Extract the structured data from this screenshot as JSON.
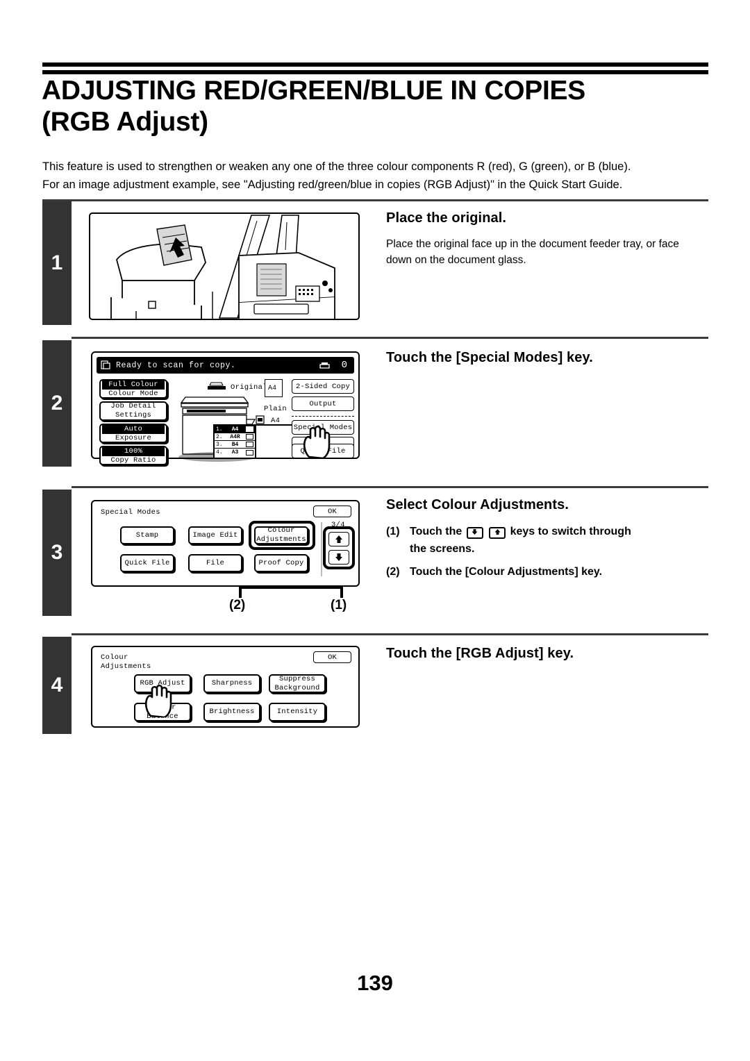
{
  "document": {
    "title_line1": "ADJUSTING RED/GREEN/BLUE IN COPIES",
    "title_line2": "(RGB Adjust)",
    "intro_line1": "This feature is used to strengthen or weaken any one of the three colour components R (red), G (green), or B (blue).",
    "intro_line2": "For an image adjustment example, see \"Adjusting red/green/blue in copies (RGB Adjust)\" in the Quick Start Guide.",
    "page_number": "139"
  },
  "steps": [
    {
      "number": "1",
      "heading": "Place the original.",
      "body_line1": "Place the original face up in the document feeder tray, or face",
      "body_line2": "down on the document glass."
    },
    {
      "number": "2",
      "heading": "Touch the [Special Modes] key."
    },
    {
      "number": "3",
      "heading": "Select Colour Adjustments.",
      "items": [
        {
          "index": "(1)",
          "text_before": "Touch the",
          "text_after": "keys to switch through",
          "text_second_line": "the screens."
        },
        {
          "index": "(2)",
          "text": "Touch the [Colour Adjustments] key."
        }
      ]
    },
    {
      "number": "4",
      "heading": "Touch the [RGB Adjust] key."
    }
  ],
  "screen_base": {
    "status_message": "Ready to scan for copy.",
    "copy_count": "0",
    "left_buttons": [
      {
        "value": "Full Colour",
        "label": "Colour Mode",
        "inverted": true
      },
      {
        "value": "Job Detail",
        "label": "Settings",
        "inverted": false
      },
      {
        "value": "Auto",
        "label": "Exposure",
        "inverted": true
      },
      {
        "value": "100%",
        "label": "Copy Ratio",
        "inverted": true
      }
    ],
    "original_label": "Original",
    "original_size": "A4",
    "paper_type": "Plain",
    "paper_size": "A4",
    "tray_list": [
      {
        "n": "1.",
        "size": "A4",
        "selected": true
      },
      {
        "n": "2.",
        "size": "A4R",
        "selected": false
      },
      {
        "n": "3.",
        "size": "B4",
        "selected": false
      },
      {
        "n": "4.",
        "size": "A3",
        "selected": false
      }
    ],
    "right_buttons": [
      "2-Sided Copy",
      "Output",
      "Special Modes",
      "",
      "Quick File"
    ]
  },
  "screen_special_modes": {
    "title": "Special Modes",
    "ok_label": "OK",
    "page_indicator": "3/4",
    "up_arrow": "up-arrow-icon",
    "down_arrow": "down-arrow-icon",
    "buttons": [
      "Stamp",
      "Image Edit",
      "Colour\nAdjustments",
      "Quick File",
      "File",
      "Proof Copy"
    ],
    "callouts": [
      {
        "label": "(2)"
      },
      {
        "label": "(1)"
      }
    ]
  },
  "screen_colour_adjustments": {
    "title_line1": "Colour",
    "title_line2": "Adjustments",
    "ok_label": "OK",
    "buttons": [
      "RGB Adjust",
      "Sharpness",
      "Suppress\nBackground",
      "Colour Balance",
      "Brightness",
      "Intensity"
    ]
  },
  "colors": {
    "step_bar": "#333333",
    "rule": "#000000",
    "separator": "#3a3a3a"
  }
}
